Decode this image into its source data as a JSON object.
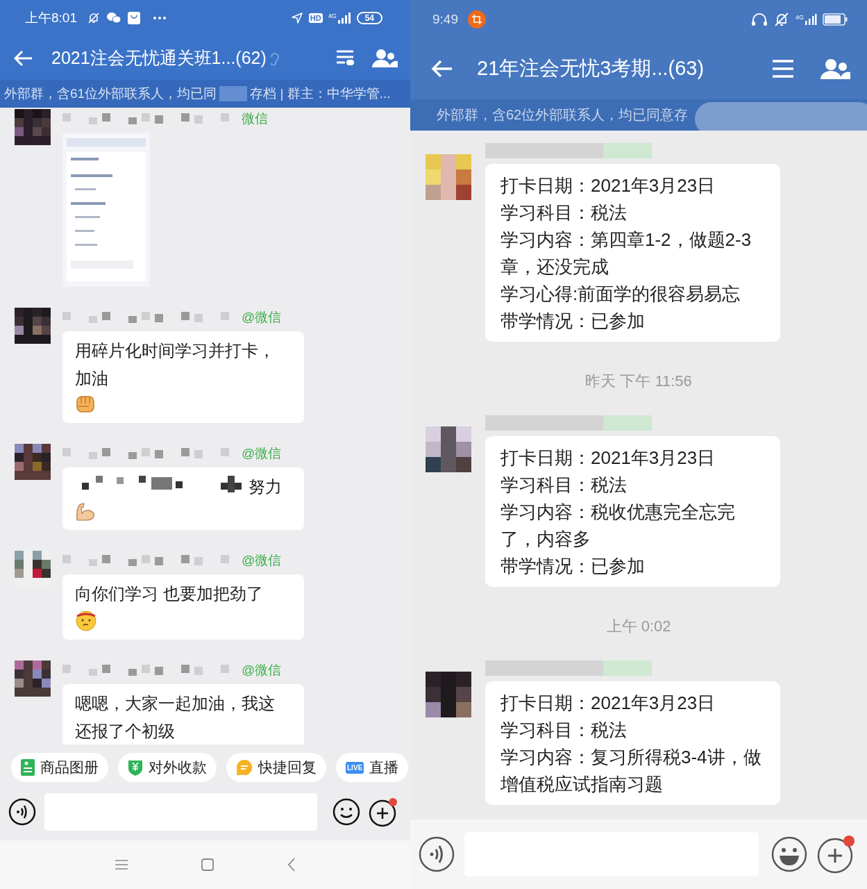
{
  "left": {
    "status_bar": {
      "time": "上午8:01",
      "hd": "HD",
      "network": "4G",
      "battery": "54"
    },
    "title": "2021注会无忧通关班1...(62)",
    "subtitle": [
      "外部群，含61位外部联系人，均已同",
      "存档 | 群主：中华学管..."
    ],
    "messages": [
      {
        "tag": "微信"
      },
      {
        "kind": "text",
        "tag": "@微信",
        "text": "用碎片化时间学习并打卡，加油"
      },
      {
        "kind": "text",
        "tag": "@微信",
        "text": "努力",
        "masked": true
      },
      {
        "kind": "text",
        "tag": "@微信",
        "text": "向你们学习 也要加把劲了"
      },
      {
        "kind": "text",
        "tag": "@微信",
        "text": "嗯嗯，大家一起加油，我这还报了个初级"
      }
    ],
    "shortcuts": [
      {
        "label": "商品图册",
        "kind": "album"
      },
      {
        "label": "对外收款",
        "kind": "payment"
      },
      {
        "label": "快捷回复",
        "kind": "reply"
      },
      {
        "label": "直播",
        "kind": "live",
        "badge": "LIVE"
      }
    ]
  },
  "right": {
    "status_bar": {
      "time": "9:49",
      "network": "4G"
    },
    "title": "21年注会无忧3考期...(63)",
    "subtitle": "外部群，含62位外部联系人，均已同意存",
    "items": [
      {
        "kind": "card",
        "lines": [
          "打卡日期：2021年3月23日",
          "学习科目：税法",
          "学习内容：第四章1-2，做题2-3章，还没完成",
          "学习心得:前面学的很容易易忘",
          "带学情况：已参加"
        ]
      },
      {
        "kind": "time",
        "text": "昨天  下午 11:56"
      },
      {
        "kind": "card",
        "lines": [
          "打卡日期：2021年3月23日",
          "学习科目：税法",
          "学习内容：税收优惠完全忘完了，内容多",
          "带学情况：已参加"
        ]
      },
      {
        "kind": "time",
        "text": "上午 0:02"
      },
      {
        "kind": "card",
        "lines": [
          "打卡日期：2021年3月23日",
          "学习科目：税法",
          "学习内容：复习所得税3-4讲，做增值税应试指南习题"
        ]
      }
    ]
  }
}
